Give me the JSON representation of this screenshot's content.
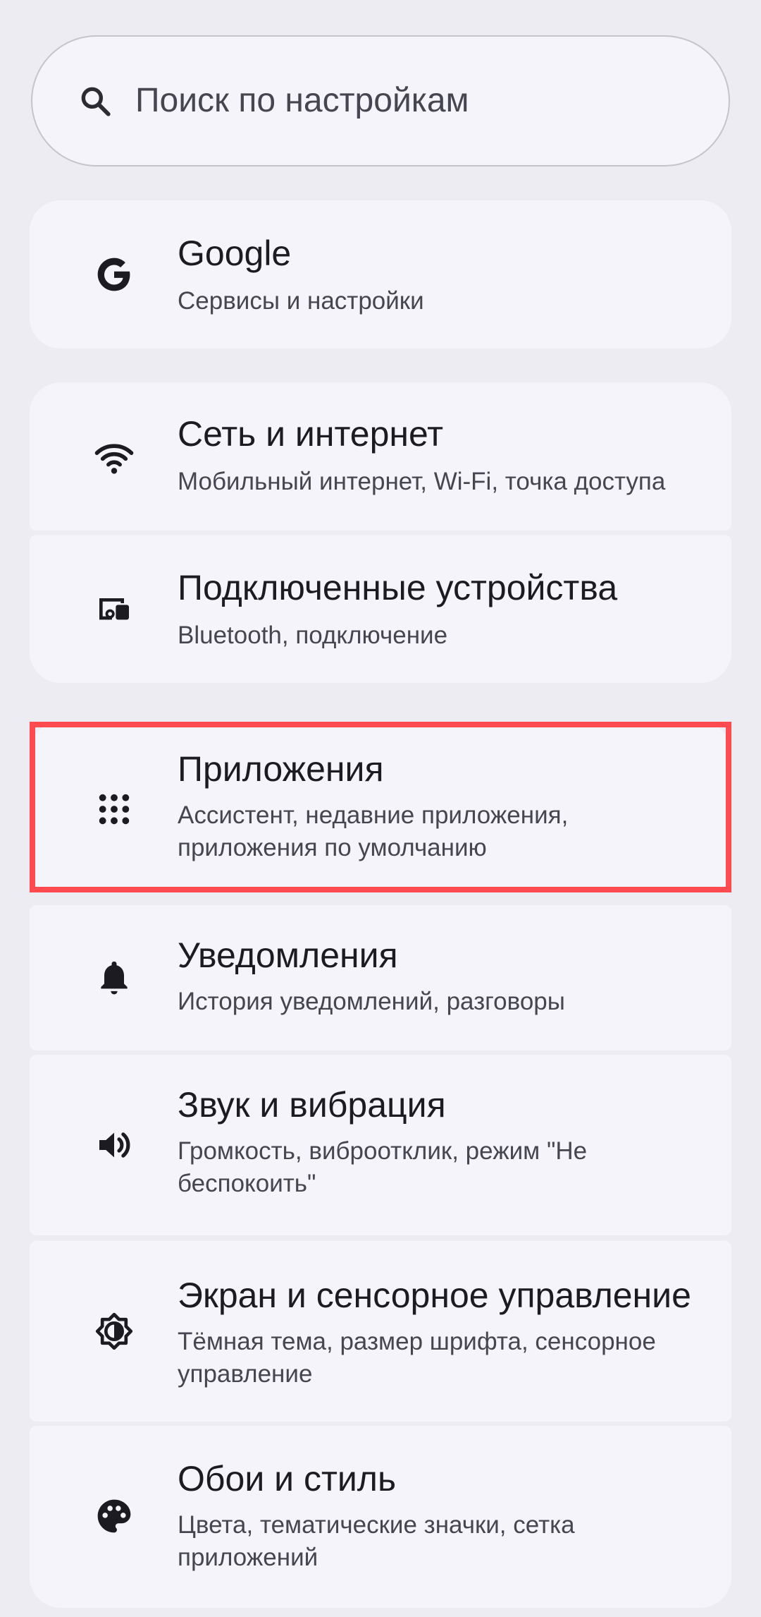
{
  "search": {
    "placeholder": "Поиск по настройкам",
    "icon": "search-icon"
  },
  "items": [
    {
      "id": "google",
      "icon": "google-g-icon",
      "title": "Google",
      "subtitle": "Сервисы и настройки"
    },
    {
      "id": "network",
      "icon": "wifi-icon",
      "title": "Сеть и интернет",
      "subtitle": "Мобильный интернет, Wi-Fi, точка доступа"
    },
    {
      "id": "connected",
      "icon": "connected-devices-icon",
      "title": "Подключенные устройства",
      "subtitle": "Bluetooth, подключение"
    },
    {
      "id": "apps",
      "icon": "apps-grid-icon",
      "title": "Приложения",
      "subtitle": "Ассистент, недавние приложения, приложения по умолчанию"
    },
    {
      "id": "notifications",
      "icon": "bell-icon",
      "title": "Уведомления",
      "subtitle": "История уведомлений, разговоры"
    },
    {
      "id": "sound",
      "icon": "volume-icon",
      "title": "Звук и вибрация",
      "subtitle": "Громкость, виброотклик, режим \"Не беспокоить\""
    },
    {
      "id": "display",
      "icon": "brightness-icon",
      "title": "Экран и сенсорное управление",
      "subtitle": "Тёмная тема, размер шрифта, сенсорное управление"
    },
    {
      "id": "wallpaper",
      "icon": "palette-icon",
      "title": "Обои и стиль",
      "subtitle": "Цвета, тематические значки, сетка приложений"
    }
  ],
  "highlight": {
    "target": "apps",
    "color": "#ff4b4f"
  },
  "colors": {
    "background": "#edecf3",
    "card": "#f6f4fb",
    "text": "#1b1b21",
    "secondary": "#45464f"
  }
}
